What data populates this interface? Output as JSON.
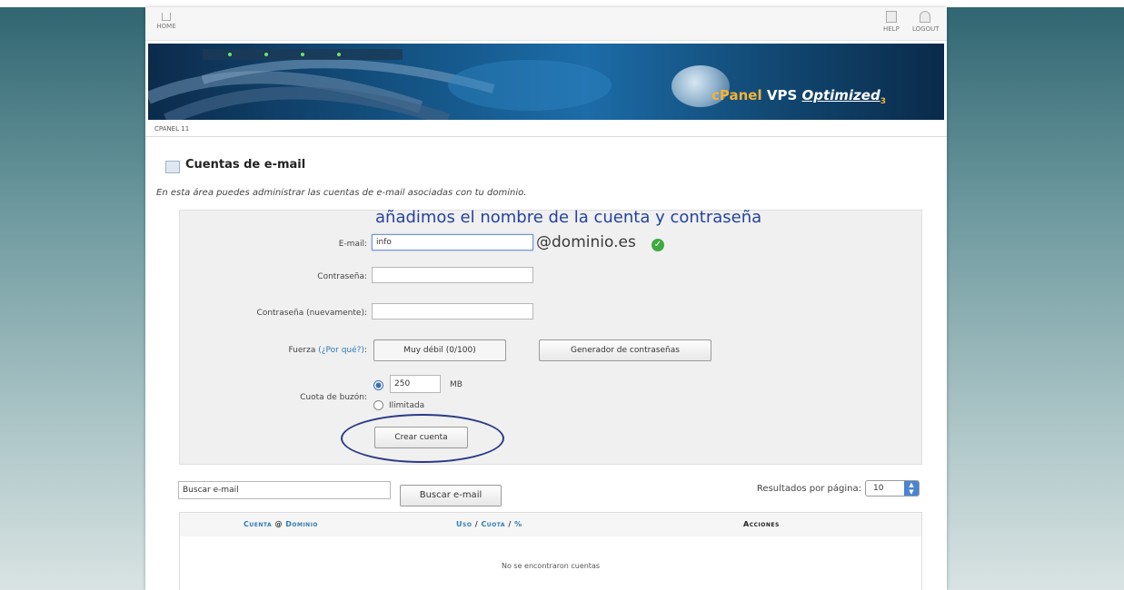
{
  "toolbar": {
    "home_label": "HOME",
    "help_label": "HELP",
    "logout_label": "LOGOUT"
  },
  "banner": {
    "logo_cpanel": "cPanel",
    "logo_vps": "VPS",
    "logo_optimized": "Optimized",
    "logo_version": "3"
  },
  "breadcrumb": {
    "label": "CPANEL 11"
  },
  "section": {
    "title": "Cuentas de e-mail",
    "description": "En esta área puedes administrar las cuentas de e-mail asociadas con tu dominio."
  },
  "annotation": "añadimos el nombre de la cuenta y contraseña",
  "form": {
    "email_label": "E-mail:",
    "email_value": "info",
    "domain": "@dominio.es",
    "password_label": "Contraseña:",
    "password_again_label": "Contraseña (nuevamente):",
    "strength_label": "Fuerza",
    "strength_link": "(¿Por qué?)",
    "strength_suffix": ":",
    "strength_value": "Muy débil (0/100)",
    "generator_button": "Generador de contraseñas",
    "quota_label": "Cuota de buzón:",
    "quota_value": "250",
    "quota_unit": "MB",
    "quota_unlimited": "Ilimitada",
    "create_button": "Crear cuenta"
  },
  "search": {
    "input_value": "Buscar e-mail",
    "button_label": "Buscar e-mail",
    "results_label": "Resultados por página:",
    "results_value": "10"
  },
  "table": {
    "headers": {
      "account": "Cuenta",
      "at": "@",
      "domain": "Dominio",
      "usage": "Uso",
      "quota": "Cuota",
      "pct": "%",
      "actions": "Acciones"
    },
    "empty_message": "No se encontraron cuentas"
  },
  "colors": {
    "link": "#2e7bb4",
    "annotation": "#2542a0",
    "check": "#3faa3f"
  }
}
